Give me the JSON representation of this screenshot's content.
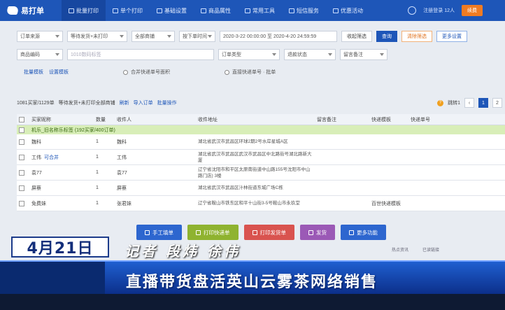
{
  "app": {
    "logo": "易打单"
  },
  "nav": [
    {
      "label": "批量打印",
      "active": true
    },
    {
      "label": "单个打印",
      "active": false
    },
    {
      "label": "基础设置",
      "active": false
    },
    {
      "label": "商品属性",
      "active": false
    },
    {
      "label": "常用工具",
      "active": false
    },
    {
      "label": "短信服务",
      "active": false
    },
    {
      "label": "优惠活动",
      "active": false
    }
  ],
  "topright": {
    "account": "注册登录 12人",
    "upgrade": "续费"
  },
  "filters": {
    "row1": {
      "order_source": "订单来源",
      "wait_print": "等待发货+未打印",
      "all_shops": "全部商铺",
      "order_time": "按下单时间",
      "date_range": "2020-3-22 00:00:00 至 2020-4-20 24:59:59",
      "collapse": "收起筛选",
      "search": "查询",
      "reset": "清除筛选",
      "settings": "更多设置"
    },
    "row2": {
      "product_code": "商品编码",
      "code_placeholder": "1010数码标签",
      "order_type": "订单类型",
      "refund_status": "退款状态",
      "remark": "留言备注"
    },
    "row3": {
      "link1": "批量模板",
      "link2": "设置模板",
      "radio1": "合并快递单号面积",
      "radio2": "直接快递单号 · 批单"
    }
  },
  "toolbar": {
    "count": "1081买家/1129单",
    "hint": "等待发货+未打印全部商铺",
    "refresh": "刷新",
    "import": "导入订单",
    "batch": "批量操作",
    "pager_label": "跳转1",
    "page1": "1",
    "page2": "2"
  },
  "table": {
    "headers": [
      "买家昵称",
      "数量",
      "收件人",
      "收件地址",
      "留言备注",
      "快递模板",
      "快递单号"
    ],
    "group": "机乐_旧名称乐标签 (192买家/400订单)",
    "rows": [
      {
        "name": "魏科",
        "qty": "1",
        "receiver": "魏科",
        "addr": "湖北省武汉市武昌区环球2期2号水岸星城A区",
        "tag": "",
        "tpl": ""
      },
      {
        "name": "工伟",
        "qty": "1",
        "receiver": "工伟",
        "addr": "湖北省武汉市武昌区武汉市武昌区中北路街号湖北路新大厦",
        "tag": "可合并",
        "tpl": ""
      },
      {
        "name": "袁77",
        "qty": "1",
        "receiver": "袁77",
        "addr": "辽宁省沈阳市和平区太原南街道中山路155号沈阳市中山路门店) 3楼",
        "tag": "",
        "tpl": ""
      },
      {
        "name": "屏蔡",
        "qty": "1",
        "receiver": "屏蔡",
        "addr": "湖北省武汉市武昌区汁林街道东城广场C栋",
        "tag": "",
        "tpl": ""
      },
      {
        "name": "免费妹",
        "qty": "1",
        "receiver": "张君妹",
        "addr": "辽宁省鞍山市铁东区和平十山街3-5号鞍山市永玖堂",
        "tag": "",
        "tpl": "百世快递模板"
      }
    ]
  },
  "actions": [
    {
      "label": "手工填单",
      "color": "#2d66cf"
    },
    {
      "label": "打印快递单",
      "color": "#8fb330"
    },
    {
      "label": "打印发货单",
      "color": "#d9534f"
    },
    {
      "label": "发货",
      "color": "#9b59b6"
    },
    {
      "label": "更多功能",
      "color": "#2d66cf"
    }
  ],
  "status": {
    "left": "热点资讯",
    "right": "已读链接"
  },
  "overlay": {
    "date": "4月21日",
    "reporter": "记者 段炜 徐伟",
    "headline": "直播带货盘活英山云雾茶网络销售"
  }
}
